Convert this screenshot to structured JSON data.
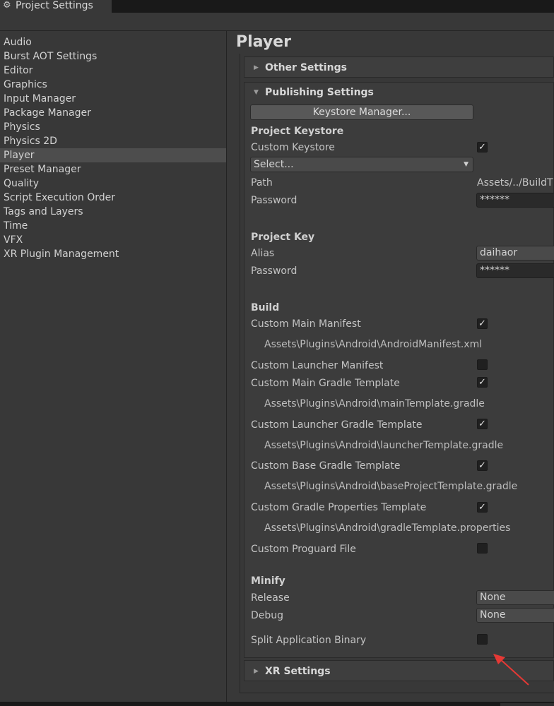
{
  "window": {
    "tab_title": "Project Settings",
    "gear_icon": "gear-icon"
  },
  "sidebar": {
    "items": [
      {
        "label": "Audio"
      },
      {
        "label": "Burst AOT Settings"
      },
      {
        "label": "Editor"
      },
      {
        "label": "Graphics"
      },
      {
        "label": "Input Manager"
      },
      {
        "label": "Package Manager"
      },
      {
        "label": "Physics"
      },
      {
        "label": "Physics 2D"
      },
      {
        "label": "Player",
        "selected": true
      },
      {
        "label": "Preset Manager"
      },
      {
        "label": "Quality"
      },
      {
        "label": "Script Execution Order"
      },
      {
        "label": "Tags and Layers"
      },
      {
        "label": "Time"
      },
      {
        "label": "VFX"
      },
      {
        "label": "XR Plugin Management"
      }
    ]
  },
  "main": {
    "title": "Player",
    "other_settings": "Other Settings",
    "publishing": {
      "title": "Publishing Settings",
      "keystore_button": "Keystore Manager...",
      "project_keystore": "Project Keystore",
      "custom_keystore": {
        "label": "Custom Keystore",
        "checked": true
      },
      "select": "Select...",
      "path_label": "Path",
      "path_value": "Assets/../BuildT",
      "keystore_password_label": "Password",
      "keystore_password_value": "******",
      "project_key": "Project Key",
      "alias_label": "Alias",
      "alias_value": "daihaor",
      "key_password_label": "Password",
      "key_password_value": "******",
      "build": "Build",
      "custom_main_manifest": {
        "label": "Custom Main Manifest",
        "checked": true,
        "path": "Assets\\Plugins\\Android\\AndroidManifest.xml"
      },
      "custom_launcher_manifest": {
        "label": "Custom Launcher Manifest",
        "checked": false
      },
      "custom_main_gradle": {
        "label": "Custom Main Gradle Template",
        "checked": true,
        "path": "Assets\\Plugins\\Android\\mainTemplate.gradle"
      },
      "custom_launcher_gradle": {
        "label": "Custom Launcher Gradle Template",
        "checked": true,
        "path": "Assets\\Plugins\\Android\\launcherTemplate.gradle"
      },
      "custom_base_gradle": {
        "label": "Custom Base Gradle Template",
        "checked": true,
        "path": "Assets\\Plugins\\Android\\baseProjectTemplate.gradle"
      },
      "custom_gradle_props": {
        "label": "Custom Gradle Properties Template",
        "checked": true,
        "path": "Assets\\Plugins\\Android\\gradleTemplate.properties"
      },
      "custom_proguard": {
        "label": "Custom Proguard File",
        "checked": false
      },
      "minify": "Minify",
      "release_label": "Release",
      "release_value": "None",
      "debug_label": "Debug",
      "debug_value": "None",
      "split_binary": {
        "label": "Split Application Binary",
        "checked": false
      }
    },
    "xr_settings": "XR Settings"
  },
  "colors": {
    "annotation_arrow": "#e53935",
    "selected_item": "#4d4d4d"
  }
}
